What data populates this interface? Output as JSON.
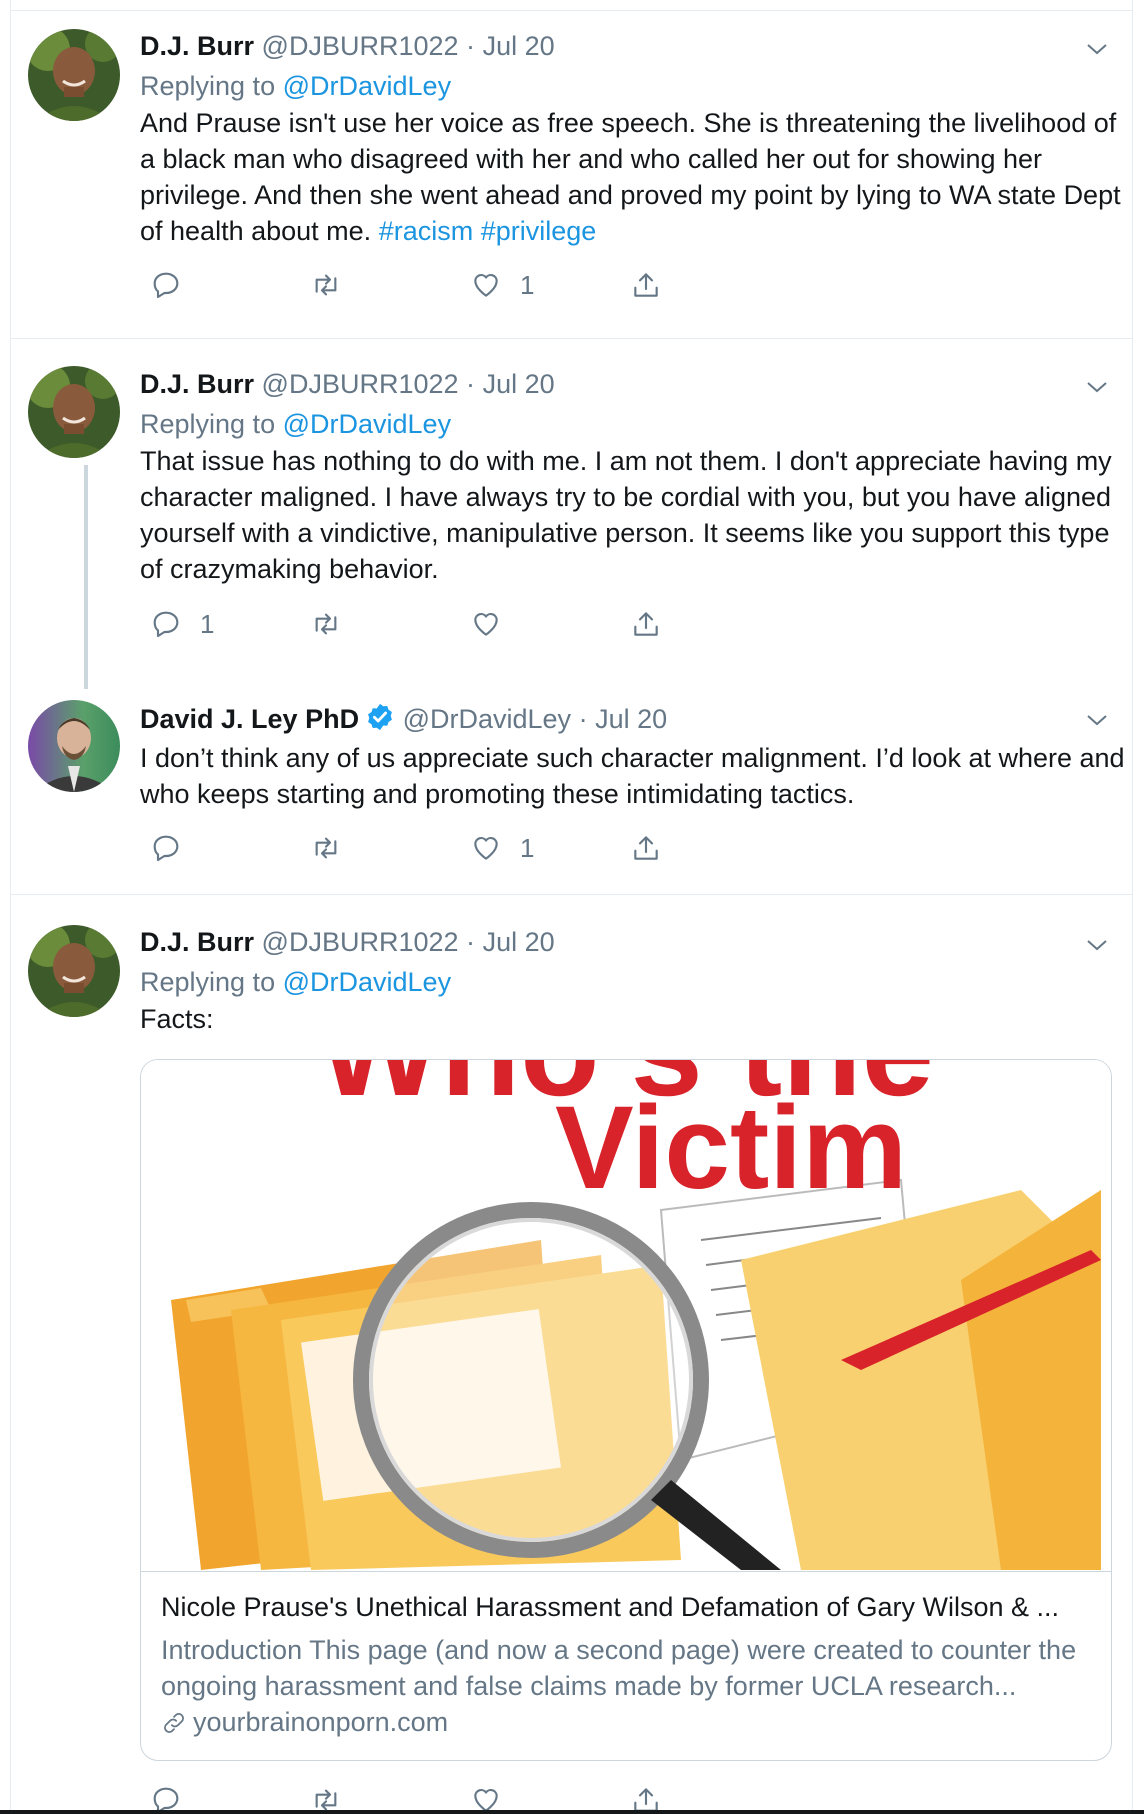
{
  "tweets": [
    {
      "name": "D.J. Burr",
      "handle": "@DJBURR1022",
      "sep": "·",
      "date": "Jul 20",
      "replying_prefix": "Replying to",
      "replying_to": "@DrDavidLey",
      "text": "And Prause isn't use her voice as free speech. She is threatening the livelihood of a black man who disagreed with her and who called her out for showing her privilege. And then she went ahead and proved my point by lying to WA state Dept of health about me.",
      "hashtags": [
        "#racism",
        "#privilege"
      ],
      "reply_count": "",
      "retweet_count": "",
      "like_count": "1"
    },
    {
      "name": "D.J. Burr",
      "handle": "@DJBURR1022",
      "sep": "·",
      "date": "Jul 20",
      "replying_prefix": "Replying to",
      "replying_to": "@DrDavidLey",
      "text": "That issue has nothing to do with me. I am not them.  I don't appreciate having my character maligned. I have always try to be cordial with you, but you have aligned yourself with a vindictive, manipulative person. It seems like you support this type of crazymaking behavior.",
      "reply_count": "1",
      "retweet_count": "",
      "like_count": ""
    },
    {
      "name": "David J. Ley PhD",
      "handle": "@DrDavidLey",
      "sep": "·",
      "date": "Jul 20",
      "text": "I don’t think any of us appreciate such character malignment. I’d look at where and who keeps starting and promoting these intimidating tactics.",
      "reply_count": "",
      "retweet_count": "",
      "like_count": "1"
    },
    {
      "name": "D.J. Burr",
      "handle": "@DJBURR1022",
      "sep": "·",
      "date": "Jul 20",
      "replying_prefix": "Replying to",
      "replying_to": "@DrDavidLey",
      "text": "Facts:",
      "card": {
        "image_text_top": "Who's the",
        "image_text_main": "Victim",
        "title": "Nicole Prause's Unethical Harassment and Defamation of Gary Wilson & ...",
        "description": "Introduction This page (and now a second page) were created to counter the ongoing harassment and false claims made by former UCLA research...",
        "domain": "yourbrainonporn.com"
      }
    }
  ],
  "colors": {
    "accent": "#1b95e0",
    "verified": "#1da1f2",
    "muted": "#657786",
    "border": "#e6ecf0",
    "image_red": "#d8232a",
    "folder_orange": "#f5a623"
  },
  "icons": [
    "reply-icon",
    "retweet-icon",
    "like-icon",
    "share-icon",
    "chevron-down-icon",
    "verified-badge-icon",
    "link-icon"
  ]
}
